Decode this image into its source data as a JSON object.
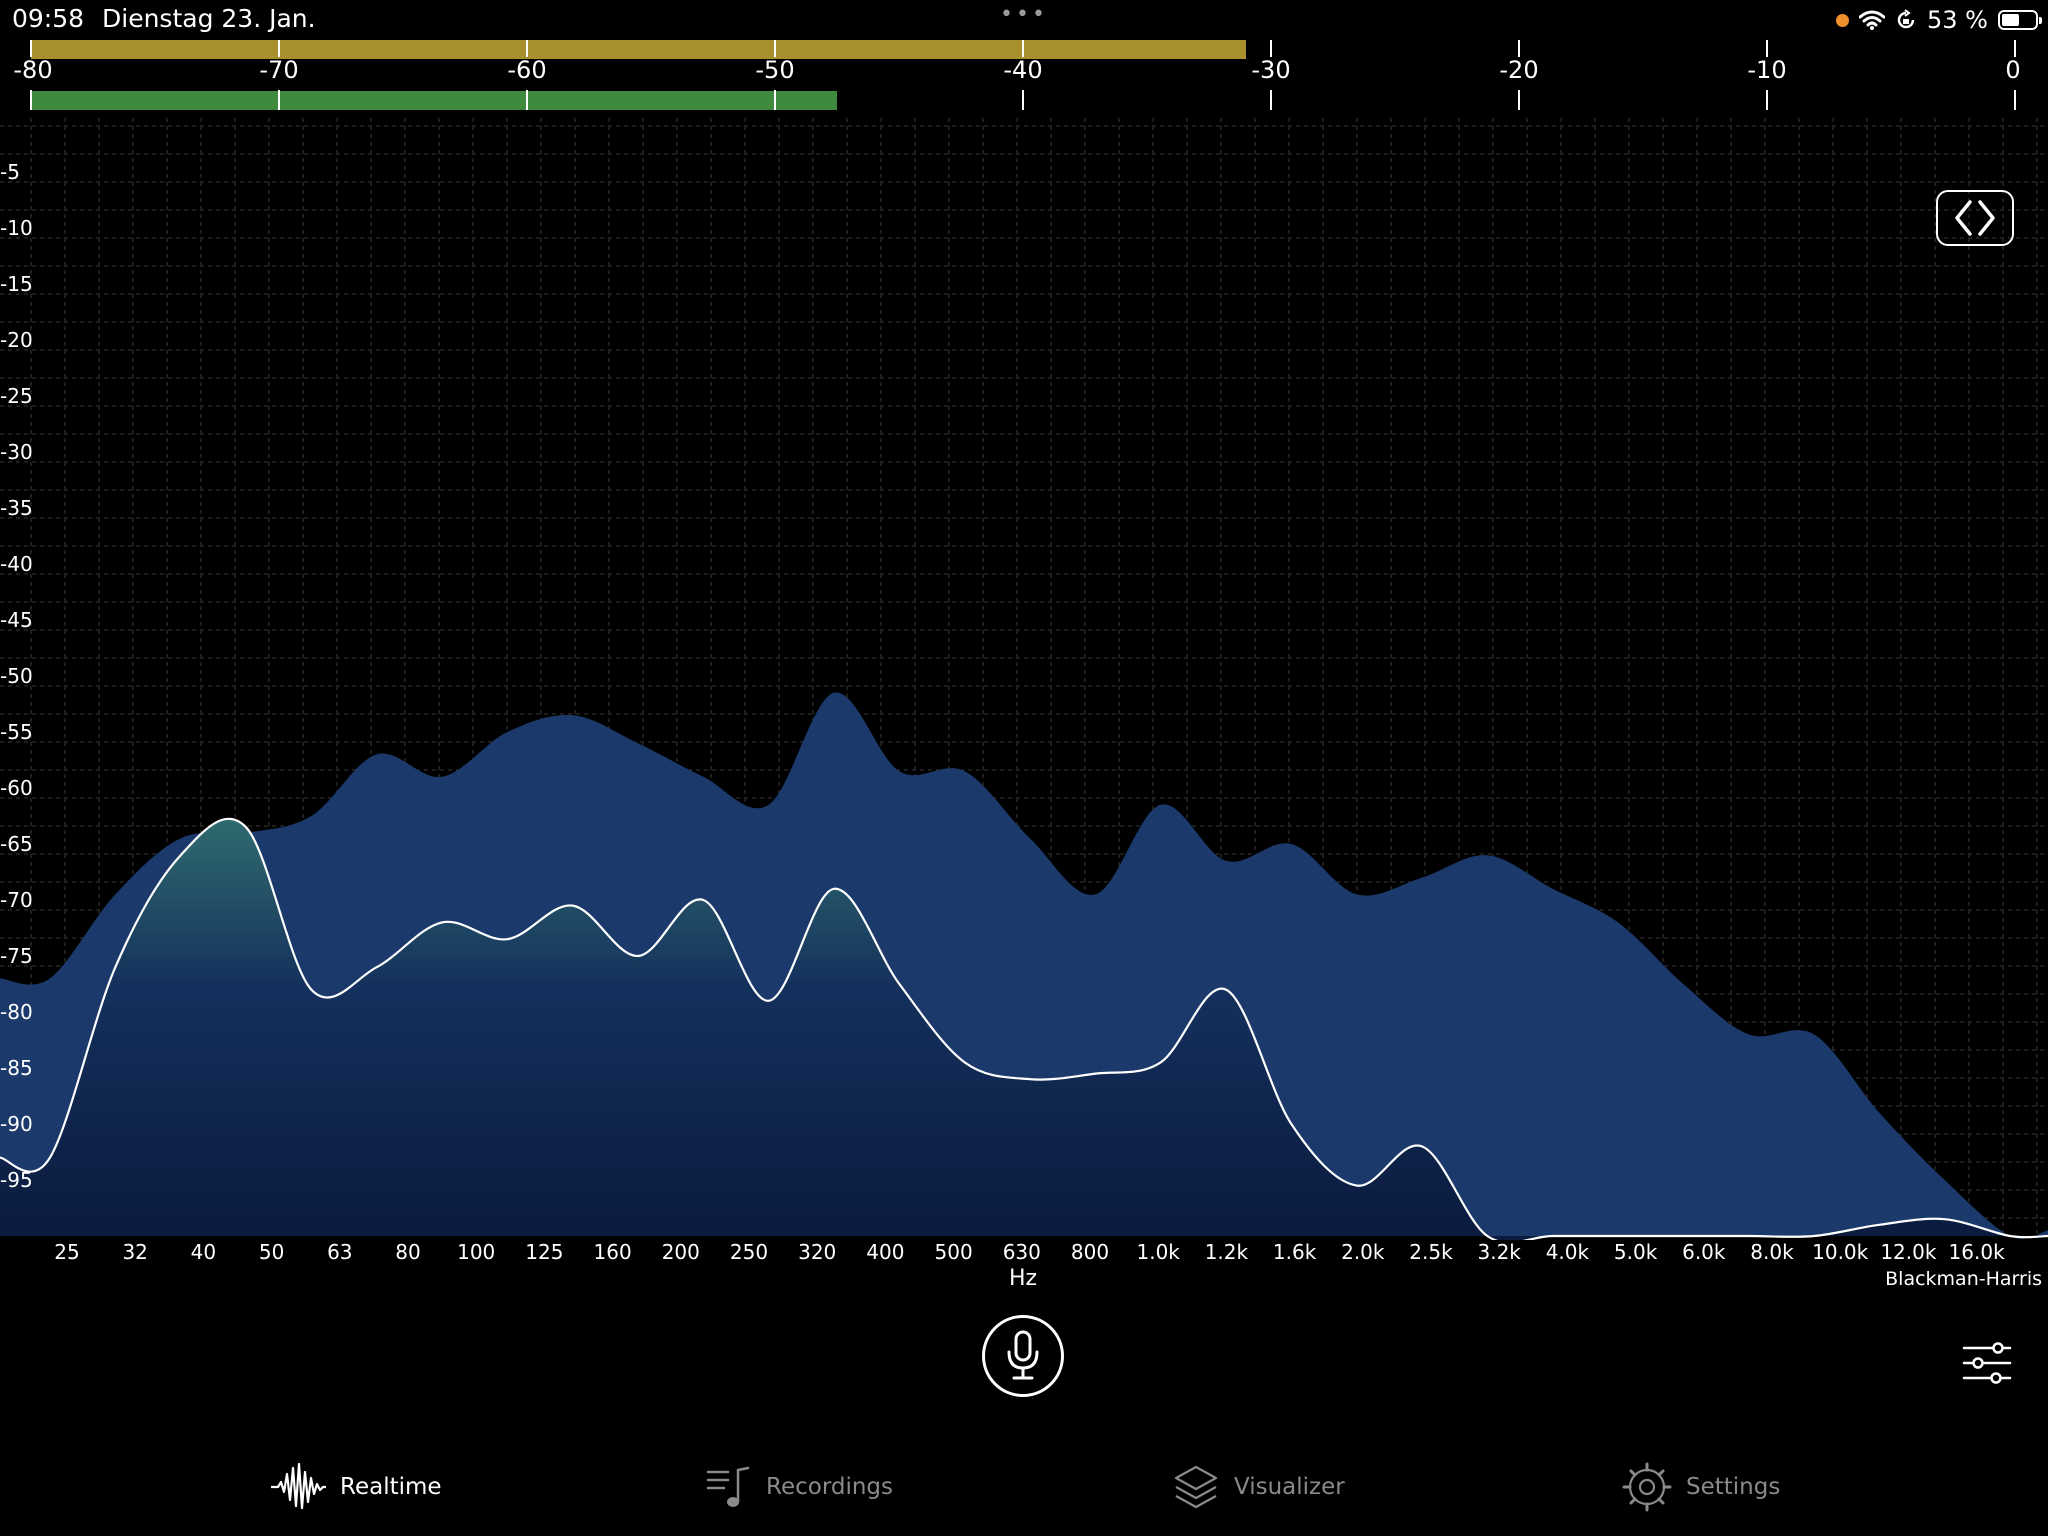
{
  "status_bar": {
    "time": "09:58",
    "date": "Dienstag 23. Jan.",
    "dots": "•••",
    "battery_percent": "53 %",
    "battery_level": 0.53
  },
  "level_meter": {
    "scale_labels": [
      "-80",
      "-70",
      "-60",
      "-50",
      "-40",
      "-30",
      "-20",
      "-10",
      "0"
    ],
    "peak_level_db": -31,
    "rms_level_db": -47.5,
    "peak_color": "#a8902e",
    "rms_color": "#3e8a3e"
  },
  "spectrum": {
    "db_labels": [
      "-5",
      "-10",
      "-15",
      "-20",
      "-25",
      "-30",
      "-35",
      "-40",
      "-45",
      "-50",
      "-55",
      "-60",
      "-65",
      "-70",
      "-75",
      "-80",
      "-85",
      "-90",
      "-95"
    ],
    "freq_labels": [
      "25",
      "32",
      "40",
      "50",
      "63",
      "80",
      "100",
      "125",
      "160",
      "200",
      "250",
      "320",
      "400",
      "500",
      "630",
      "800",
      "1.0k",
      "1.2k",
      "1.6k",
      "2.0k",
      "2.5k",
      "3.2k",
      "4.0k",
      "5.0k",
      "6.0k",
      "8.0k",
      "10.0k",
      "12.0k",
      "16.0k"
    ],
    "x_unit": "Hz",
    "window_function": "Blackman-Harris",
    "fill_color": "#1b3a6b",
    "line_color": "#ffffff",
    "peak_hold_db": [
      -77,
      -77,
      -69.5,
      -64.5,
      -64,
      -62.5,
      -57,
      -59,
      -55,
      -53.5,
      -56,
      -59,
      -61.5,
      -51.5,
      -58.5,
      -58.5,
      -64.5,
      -69.5,
      -61.5,
      -66.5,
      -65,
      -69.5,
      -68,
      -66,
      -69,
      -72,
      -77.5,
      -82,
      -82,
      -89,
      -95,
      -100,
      -99.5
    ],
    "live_db": [
      -93,
      -93,
      -76,
      -66,
      -63.5,
      -78,
      -76,
      -72,
      -73.5,
      -70.5,
      -75,
      -70,
      -79,
      -69,
      -77.5,
      -84.5,
      -86,
      -85.5,
      -84.5,
      -78,
      -90,
      -95.5,
      -92,
      -100,
      -100,
      -100,
      -100,
      -100,
      -100,
      -99,
      -98.5,
      -100,
      -100
    ]
  },
  "controls": {
    "toggle_icon": "code-brackets-icon",
    "mic_icon": "microphone-icon",
    "filters_icon": "sliders-icon"
  },
  "tabs": [
    {
      "label": "Realtime",
      "icon": "waveform-icon",
      "active": true
    },
    {
      "label": "Recordings",
      "icon": "music-list-icon",
      "active": false
    },
    {
      "label": "Visualizer",
      "icon": "layers-icon",
      "active": false
    },
    {
      "label": "Settings",
      "icon": "gear-icon",
      "active": false
    }
  ]
}
